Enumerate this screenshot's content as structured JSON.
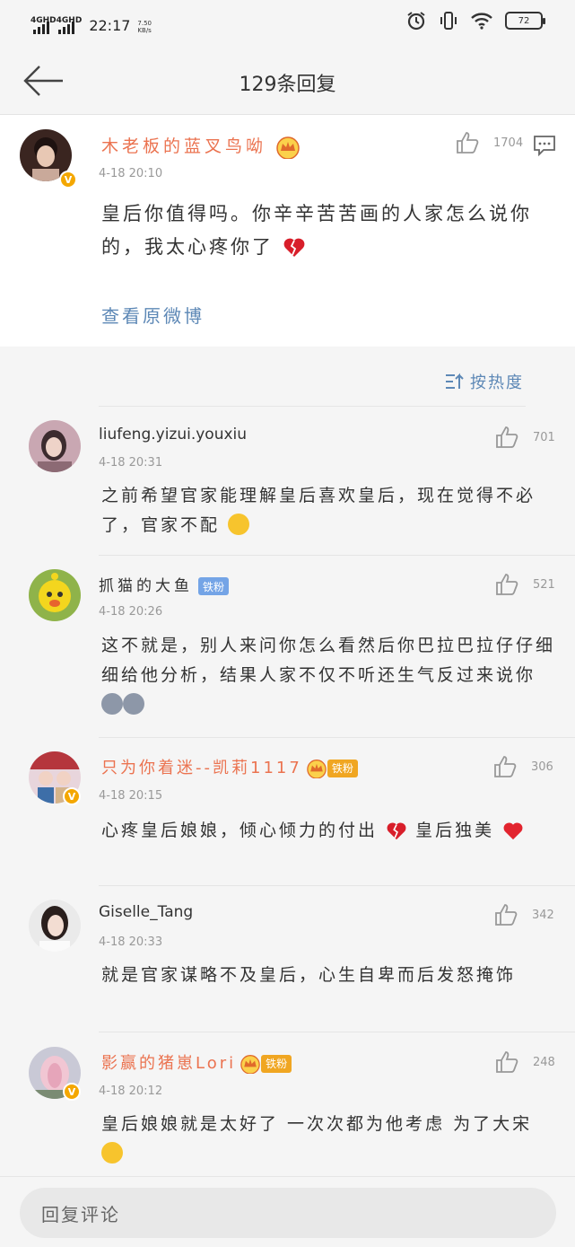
{
  "status_bar": {
    "signal1_label": "4GHD",
    "signal2_label": "4GHD",
    "time": "22:17",
    "speed_value": "7.50",
    "speed_unit": "KB/s",
    "battery": "72"
  },
  "nav": {
    "title": "129条回复"
  },
  "main_comment": {
    "username": "木老板的蓝叉鸟呦",
    "time": "4-18 20:10",
    "likes": "1704",
    "text": "皇后你值得吗。你辛辛苦苦画的人家怎么说你的，我太心疼你了",
    "view_original": "查看原微博"
  },
  "sort_label": "按热度",
  "replies": [
    {
      "username": "liufeng.yizui.youxiu",
      "time": "4-18 20:31",
      "likes": "701",
      "text": "之前希望官家能理解皇后喜欢皇后，现在觉得不必了，官家不配"
    },
    {
      "username": "抓猫的大鱼",
      "badge": "铁粉",
      "time": "4-18 20:26",
      "likes": "521",
      "text": "这不就是，别人来问你怎么看然后你巴拉巴拉仔仔细细给他分析，结果人家不仅不听还生气反过来说你"
    },
    {
      "username": "只为你着迷--凯莉1117",
      "badge": "铁粉",
      "time": "4-18 20:15",
      "likes": "306",
      "text": "心疼皇后娘娘，倾心倾力的付出",
      "text_end": "皇后独美"
    },
    {
      "username": "Giselle_Tang",
      "time": "4-18 20:33",
      "likes": "342",
      "text": "就是官家谋略不及皇后，心生自卑而后发怒掩饰"
    },
    {
      "username": "影赢的猪崽Lori",
      "badge": "铁粉",
      "time": "4-18 20:12",
      "likes": "248",
      "text": "皇后娘娘就是太好了 一次次都为他考虑 为了大宋"
    }
  ],
  "reply_bar": {
    "placeholder": "回复评论"
  },
  "colors": {
    "orange_name": "#eb7350",
    "link_blue": "#5d88b6",
    "vip_gold": "#f4a700",
    "fan_badge_blue": "#74a4e6",
    "fan_badge_gold": "#f0a622"
  }
}
